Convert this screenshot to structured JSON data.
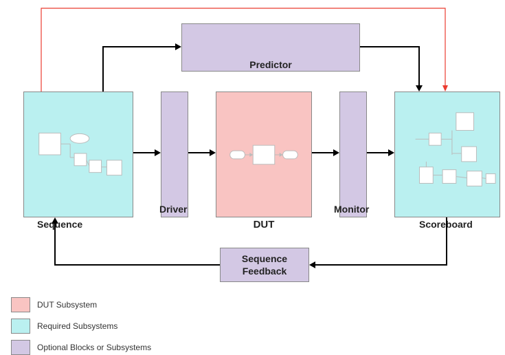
{
  "blocks": {
    "predictor": "Predictor",
    "sequence": "Sequence",
    "driver": "Driver",
    "dut": "DUT",
    "monitor": "Monitor",
    "scoreboard": "Scoreboard",
    "seq_feedback_line1": "Sequence",
    "seq_feedback_line2": "Feedback"
  },
  "legend": {
    "dut": "DUT Subsystem",
    "required": "Required Subsystems",
    "optional": "Optional Blocks or Subsystems"
  },
  "colors": {
    "dut": "#f9c4c2",
    "required": "#baf0f0",
    "optional": "#d3c8e4"
  }
}
